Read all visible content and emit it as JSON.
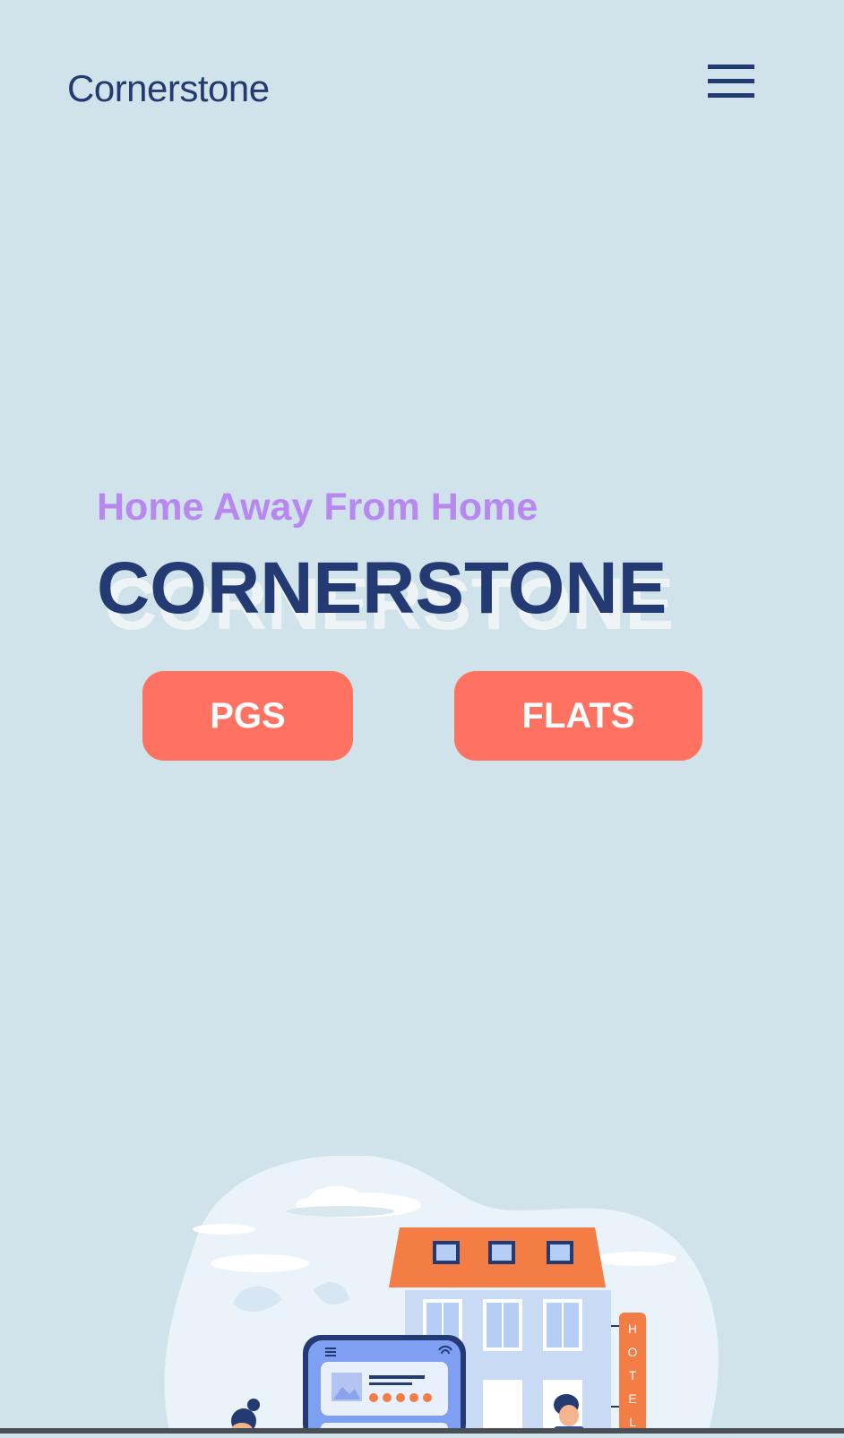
{
  "header": {
    "brand": "Cornerstone",
    "menu_icon": "hamburger-menu-icon"
  },
  "hero": {
    "tagline": "Home Away From Home",
    "title": "CORNERSTONE",
    "buttons": {
      "pgs": "PGS",
      "flats": "FLATS"
    }
  },
  "illustration": {
    "sign_letters": [
      "H",
      "O",
      "T",
      "E",
      "L"
    ],
    "icons": [
      "hotel-building-icon",
      "phone-booking-icon",
      "rating-stars-icon",
      "wifi-icon",
      "person-icon"
    ]
  },
  "colors": {
    "background": "#d0e3ea",
    "navy": "#243a72",
    "tagline_purple": "#b987f0",
    "button_coral": "#ff7262",
    "roof_orange": "#f47c45"
  }
}
